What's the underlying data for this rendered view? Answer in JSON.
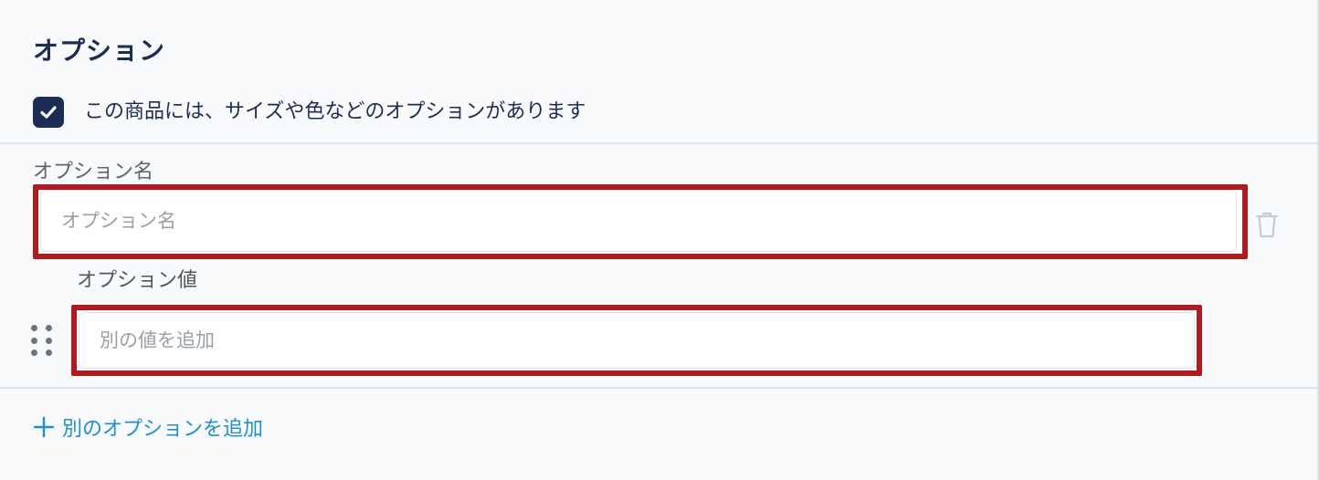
{
  "section": {
    "title": "オプション"
  },
  "has_options": {
    "checked": true,
    "label": "この商品には、サイズや色などのオプションがあります"
  },
  "option_name": {
    "label": "オプション名",
    "placeholder": "オプション名",
    "value": ""
  },
  "option_values": {
    "label": "オプション値",
    "placeholder": "別の値を追加",
    "value": ""
  },
  "add_option": {
    "label": "別のオプションを追加"
  },
  "icons": {
    "checkbox": "check-icon",
    "delete": "trash-icon",
    "drag": "drag-handle-icon",
    "add": "plus-icon"
  },
  "colors": {
    "primary_text": "#1c2d55",
    "link": "#1e8fd6",
    "highlight_border": "#b11a1e",
    "background": "#f9fafc"
  }
}
